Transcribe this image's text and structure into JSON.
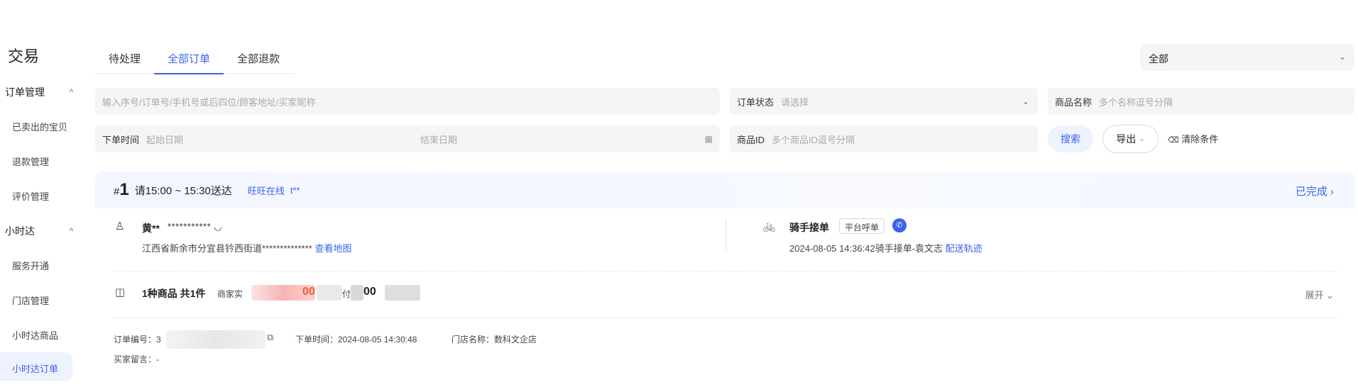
{
  "sidebar": {
    "title": "交易",
    "groups": [
      {
        "label": "订单管理",
        "items": [
          "已卖出的宝贝",
          "退款管理",
          "评价管理"
        ]
      },
      {
        "label": "小时达",
        "items": [
          "服务开通",
          "门店管理",
          "小时达商品",
          "小时达订单"
        ]
      }
    ],
    "chevron": "^"
  },
  "tabs": [
    {
      "label": "待处理"
    },
    {
      "label": "全部订单"
    },
    {
      "label": "全部退款"
    }
  ],
  "top_select": {
    "value": "全部",
    "chevron": "⌄"
  },
  "filters": {
    "search_placeholder": "输入序号/订单号/手机号或后四位/顾客地址/买家昵称",
    "status_label": "订单状态",
    "status_placeholder": "请选择",
    "goods_name_label": "商品名称",
    "goods_name_placeholder": "多个名称逗号分隔",
    "time_label": "下单时间",
    "start_placeholder": "起始日期",
    "end_placeholder": "结束日期",
    "goods_id_label": "商品ID",
    "goods_id_placeholder": "多个商品ID逗号分隔",
    "search_btn": "搜索",
    "export_btn": "导出",
    "clear_btn": "清除条件"
  },
  "order": {
    "index_prefix": "#",
    "index": "1",
    "delivery": "请15:00 ~ 15:30送达",
    "wangwang": "旺旺在线",
    "buyer_nick": "t**",
    "status": "已完成",
    "status_chevron": "›",
    "buyer_name": "黄**",
    "buyer_phone": "***********",
    "address": "江西省新余市分宜县钤西街道**************",
    "view_map": "查看地图",
    "rider_title": "骑手接单",
    "rider_tag": "平台呼单",
    "rider_info": "2024-08-05 14:36:42骑手接单-袁文志",
    "track_link": "配送轨迹",
    "goods_summary": "1种商品 共1件",
    "merchant_label": "商家实",
    "amount1": "00",
    "pay_label": "付",
    "amount2": "00",
    "expand": "展开",
    "expand_chevron": "⌄",
    "order_no_label": "订单编号：3",
    "order_time": "下单时间：2024-08-05 14:30:48",
    "store": "门店名称：数科文企店",
    "buyer_msg": "买家留言：-"
  },
  "icons": {
    "user": "♙",
    "rider": "🚲",
    "phone": "✆",
    "goods": "◫",
    "copy": "⧉",
    "calendar": "▦",
    "eraser": "⌫",
    "headset": "◡"
  }
}
